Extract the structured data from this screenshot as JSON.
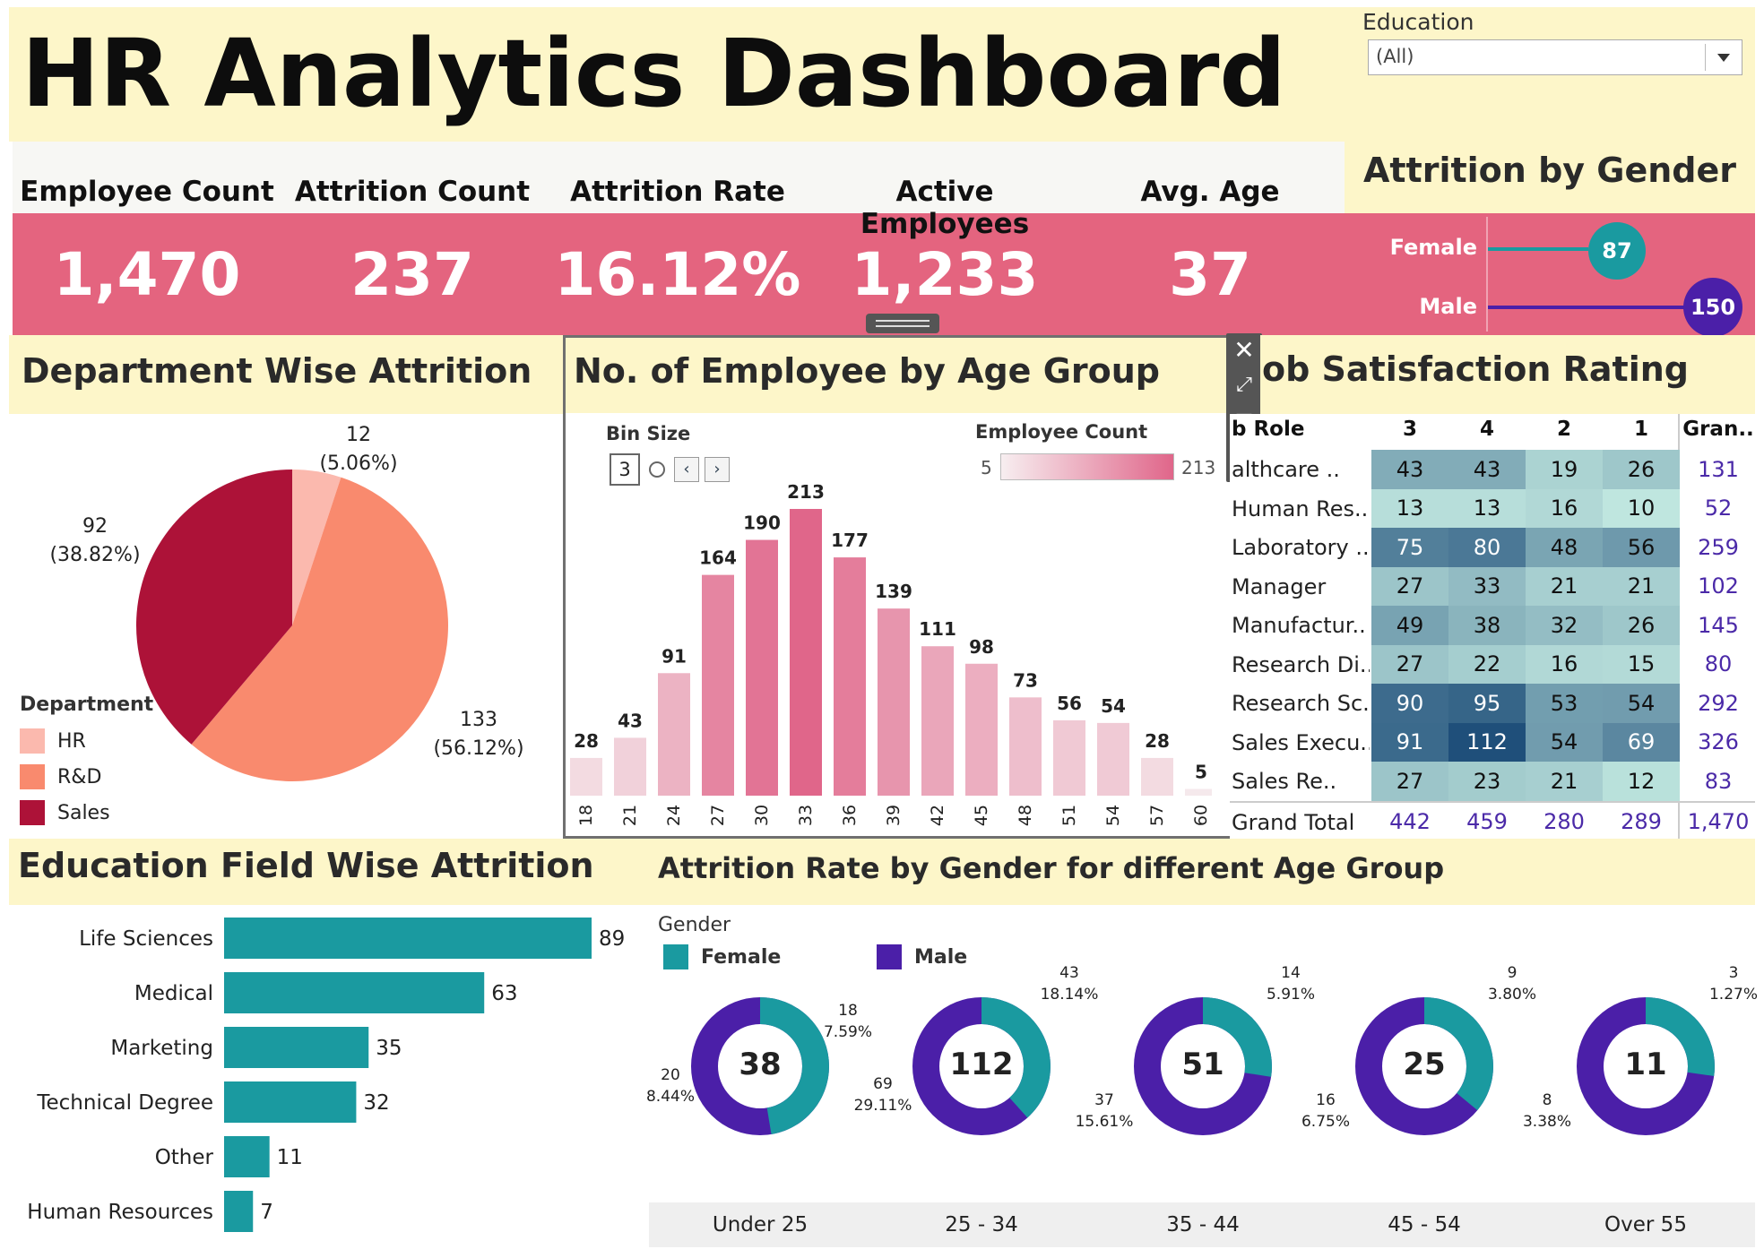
{
  "header": {
    "title": "HR Analytics Dashboard"
  },
  "filter": {
    "label": "Education",
    "selected": "(All)"
  },
  "kpis": [
    {
      "label": "Employee Count",
      "value": "1,470"
    },
    {
      "label": "Attrition Count",
      "value": "237"
    },
    {
      "label": "Attrition Rate",
      "value": "16.12%"
    },
    {
      "label": "Active Employees",
      "value": "1,233"
    },
    {
      "label": "Avg. Age",
      "value": "37"
    }
  ],
  "gender_attrition": {
    "title": "Attrition by Gender",
    "rows": [
      {
        "label": "Female",
        "value": "87",
        "color": "#1a9aa0"
      },
      {
        "label": "Male",
        "value": "150",
        "color": "#4b1fa8"
      }
    ]
  },
  "department": {
    "title": "Department Wise Attrition",
    "legend_title": "Department",
    "legend": [
      {
        "name": "HR",
        "color": "#fbb9ae"
      },
      {
        "name": "R&D",
        "color": "#f98a6e"
      },
      {
        "name": "Sales",
        "color": "#ad1238"
      }
    ],
    "labels": [
      {
        "value": "12",
        "pct": "(5.06%)"
      },
      {
        "value": "133",
        "pct": "(56.12%)"
      },
      {
        "value": "92",
        "pct": "(38.82%)"
      }
    ]
  },
  "age_hist": {
    "title": "No. of Employee by Age Group",
    "bin_label": "Bin Size",
    "bin_value": "3",
    "legend_title": "Employee Count",
    "legend_min": "5",
    "legend_max": "213"
  },
  "job_satisfaction": {
    "title": "Job Satisfaction Rating",
    "visible_title": "ob Satisfaction Rating",
    "row_header": "b Role",
    "columns": [
      "3",
      "4",
      "2",
      "1",
      "Gran.."
    ],
    "rows": [
      {
        "name": "althcare ..",
        "vals": [
          "43",
          "43",
          "19",
          "26"
        ],
        "total": "131"
      },
      {
        "name": "Human Res..",
        "vals": [
          "13",
          "13",
          "16",
          "10"
        ],
        "total": "52"
      },
      {
        "name": "Laboratory ..",
        "vals": [
          "75",
          "80",
          "48",
          "56"
        ],
        "total": "259"
      },
      {
        "name": "Manager",
        "vals": [
          "27",
          "33",
          "21",
          "21"
        ],
        "total": "102"
      },
      {
        "name": "Manufactur..",
        "vals": [
          "49",
          "38",
          "32",
          "26"
        ],
        "total": "145"
      },
      {
        "name": "Research Di..",
        "vals": [
          "27",
          "22",
          "16",
          "15"
        ],
        "total": "80"
      },
      {
        "name": "Research Sc..",
        "vals": [
          "90",
          "95",
          "53",
          "54"
        ],
        "total": "292"
      },
      {
        "name": "Sales Execu..",
        "vals": [
          "91",
          "112",
          "54",
          "69"
        ],
        "total": "326"
      },
      {
        "name": "Sales Re..",
        "vals": [
          "27",
          "23",
          "21",
          "12"
        ],
        "total": "83"
      }
    ],
    "grand_total_label": "Grand Total",
    "grand_totals": [
      "442",
      "459",
      "280",
      "289",
      "1,470"
    ]
  },
  "education_field": {
    "title": "Education Field Wise Attrition"
  },
  "age_gender": {
    "title": "Attrition Rate by Gender for different Age Group",
    "legend_title": "Gender",
    "legend": [
      {
        "name": "Female",
        "color": "#1a9aa0"
      },
      {
        "name": "Male",
        "color": "#4b1fa8"
      }
    ],
    "groups": [
      {
        "label": "Under 25",
        "total": "38",
        "female": "18",
        "female_pct": "7.59%",
        "male": "20",
        "male_pct": "8.44%",
        "female_share": 0.4737
      },
      {
        "label": "25 - 34",
        "total": "112",
        "female": "43",
        "female_pct": "18.14%",
        "male": "69",
        "male_pct": "29.11%",
        "female_share": 0.3839
      },
      {
        "label": "35 - 44",
        "total": "51",
        "female": "14",
        "female_pct": "5.91%",
        "male": "37",
        "male_pct": "15.61%",
        "female_share": 0.2745
      },
      {
        "label": "45 - 54",
        "total": "25",
        "female": "9",
        "female_pct": "3.80%",
        "male": "16",
        "male_pct": "6.75%",
        "female_share": 0.36
      },
      {
        "label": "Over 55",
        "total": "11",
        "female": "3",
        "female_pct": "1.27%",
        "male": "8",
        "male_pct": "3.38%",
        "female_share": 0.2727
      }
    ]
  },
  "chart_data": [
    {
      "type": "pie",
      "title": "Department Wise Attrition",
      "categories": [
        "HR",
        "R&D",
        "Sales"
      ],
      "values": [
        12,
        133,
        92
      ],
      "colors": [
        "#fbb9ae",
        "#f98a6e",
        "#ad1238"
      ]
    },
    {
      "type": "bar",
      "title": "No. of Employee by Age Group",
      "categories": [
        "18",
        "21",
        "24",
        "27",
        "30",
        "33",
        "36",
        "39",
        "42",
        "45",
        "48",
        "51",
        "54",
        "57",
        "60"
      ],
      "values": [
        28,
        43,
        91,
        164,
        190,
        213,
        177,
        139,
        111,
        98,
        73,
        56,
        54,
        28,
        5
      ],
      "ylim": [
        0,
        213
      ]
    },
    {
      "type": "bar",
      "title": "Education Field Wise Attrition",
      "orientation": "horizontal",
      "categories": [
        "Life Sciences",
        "Medical",
        "Marketing",
        "Technical Degree",
        "Other",
        "Human Resources"
      ],
      "values": [
        89,
        63,
        35,
        32,
        11,
        7
      ],
      "color": "#1a9aa0"
    }
  ]
}
